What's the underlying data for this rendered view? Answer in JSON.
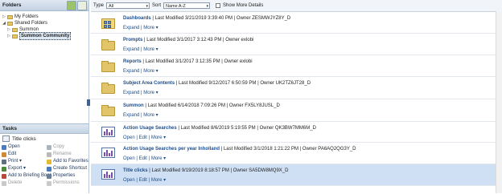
{
  "folders_panel": {
    "title": "Folders",
    "tree": [
      {
        "label": "My Folders",
        "level": 1,
        "twisty": "▷",
        "selected": false
      },
      {
        "label": "Shared Folders",
        "level": 1,
        "twisty": "◢",
        "selected": false
      },
      {
        "label": "Summon",
        "level": 2,
        "twisty": "▷",
        "selected": false
      },
      {
        "label": "Summon Community",
        "level": 2,
        "twisty": "▷",
        "selected": true
      }
    ]
  },
  "tasks_panel": {
    "title": "Tasks",
    "selected_item": "Title clicks",
    "actions": [
      {
        "label": "Open",
        "enabled": true,
        "icon": "open-icon",
        "color": "#4a7bbd"
      },
      {
        "label": "Copy",
        "enabled": false,
        "icon": "copy-icon",
        "color": "#a8b4c2"
      },
      {
        "label": "Edit",
        "enabled": true,
        "icon": "edit-icon",
        "color": "#d28a2e"
      },
      {
        "label": "Rename",
        "enabled": false,
        "icon": "rename-icon",
        "color": "#b9b9b9"
      },
      {
        "label": "Print ▾",
        "enabled": true,
        "icon": "print-icon",
        "color": "#5f6f80"
      },
      {
        "label": "Add to Favorites",
        "enabled": true,
        "icon": "favorites-icon",
        "color": "#e7b833"
      },
      {
        "label": "Export ▾",
        "enabled": true,
        "icon": "export-icon",
        "color": "#4d8a3c"
      },
      {
        "label": "Create Shortcut",
        "enabled": true,
        "icon": "shortcut-icon",
        "color": "#4a7bbd"
      },
      {
        "label": "Add to Briefing Book",
        "enabled": true,
        "icon": "briefing-book-icon",
        "color": "#b94a3a"
      },
      {
        "label": "Properties",
        "enabled": true,
        "icon": "properties-icon",
        "color": "#6a7f96"
      },
      {
        "label": "Delete",
        "enabled": false,
        "icon": "delete-icon",
        "color": "#c9c9c9"
      },
      {
        "label": "Permissions",
        "enabled": false,
        "icon": "permissions-icon",
        "color": "#c9c9c9"
      }
    ]
  },
  "toolbar": {
    "type_label": "Type",
    "type_value": "All",
    "sort_label": "Sort",
    "sort_value": "Name A-Z",
    "show_more_label": "Show More Details"
  },
  "items": [
    {
      "name": "Dashboards",
      "modified": "Last Modified 3/21/2019 3:39:40 PM",
      "owner": "Owner ZESMWJYZ8Y_D",
      "links": [
        "Expand",
        "More ▾"
      ],
      "kind": "dashboard-folder",
      "selected": false
    },
    {
      "name": "Prompts",
      "modified": "Last Modified 3/1/2017 3:12:43 PM",
      "owner": "Owner exlobi",
      "links": [
        "Expand",
        "More ▾"
      ],
      "kind": "folder",
      "selected": false
    },
    {
      "name": "Reports",
      "modified": "Last Modified 3/1/2017 3:12:35 PM",
      "owner": "Owner exlobi",
      "links": [
        "Expand",
        "More ▾"
      ],
      "kind": "folder",
      "selected": false
    },
    {
      "name": "Subject Area Contents",
      "modified": "Last Modified 9/12/2017 6:50:59 PM",
      "owner": "Owner UK2TZ6JT28_D",
      "links": [
        "Expand",
        "More ▾"
      ],
      "kind": "folder",
      "selected": false
    },
    {
      "name": "Summon",
      "modified": "Last Modified 6/14/2018 7:09:26 PM",
      "owner": "Owner FX5LY8JUSL_D",
      "links": [
        "Expand",
        "More ▾"
      ],
      "kind": "folder",
      "selected": false
    },
    {
      "name": "Action Usage Searches",
      "modified": "Last Modified 8/6/2019 5:19:55 PM",
      "owner": "Owner QK3BW7MM6M_D",
      "links": [
        "Open",
        "Edit",
        "More ▾"
      ],
      "kind": "analysis",
      "selected": false
    },
    {
      "name": "Action Usage Searches per year Inholland",
      "modified": "Last Modified 3/1/2018 1:21:22 PM",
      "owner": "Owner PA6AQ2QG3Y_D",
      "links": [
        "Open",
        "Edit",
        "More ▾"
      ],
      "kind": "analysis",
      "selected": false
    },
    {
      "name": "Title clicks",
      "modified": "Last Modified 9/19/2019 8:18:57 PM",
      "owner": "Owner SA5DW8MQ9X_D",
      "links": [
        "Open",
        "Edit",
        "More ▾"
      ],
      "kind": "analysis",
      "selected": true
    }
  ]
}
